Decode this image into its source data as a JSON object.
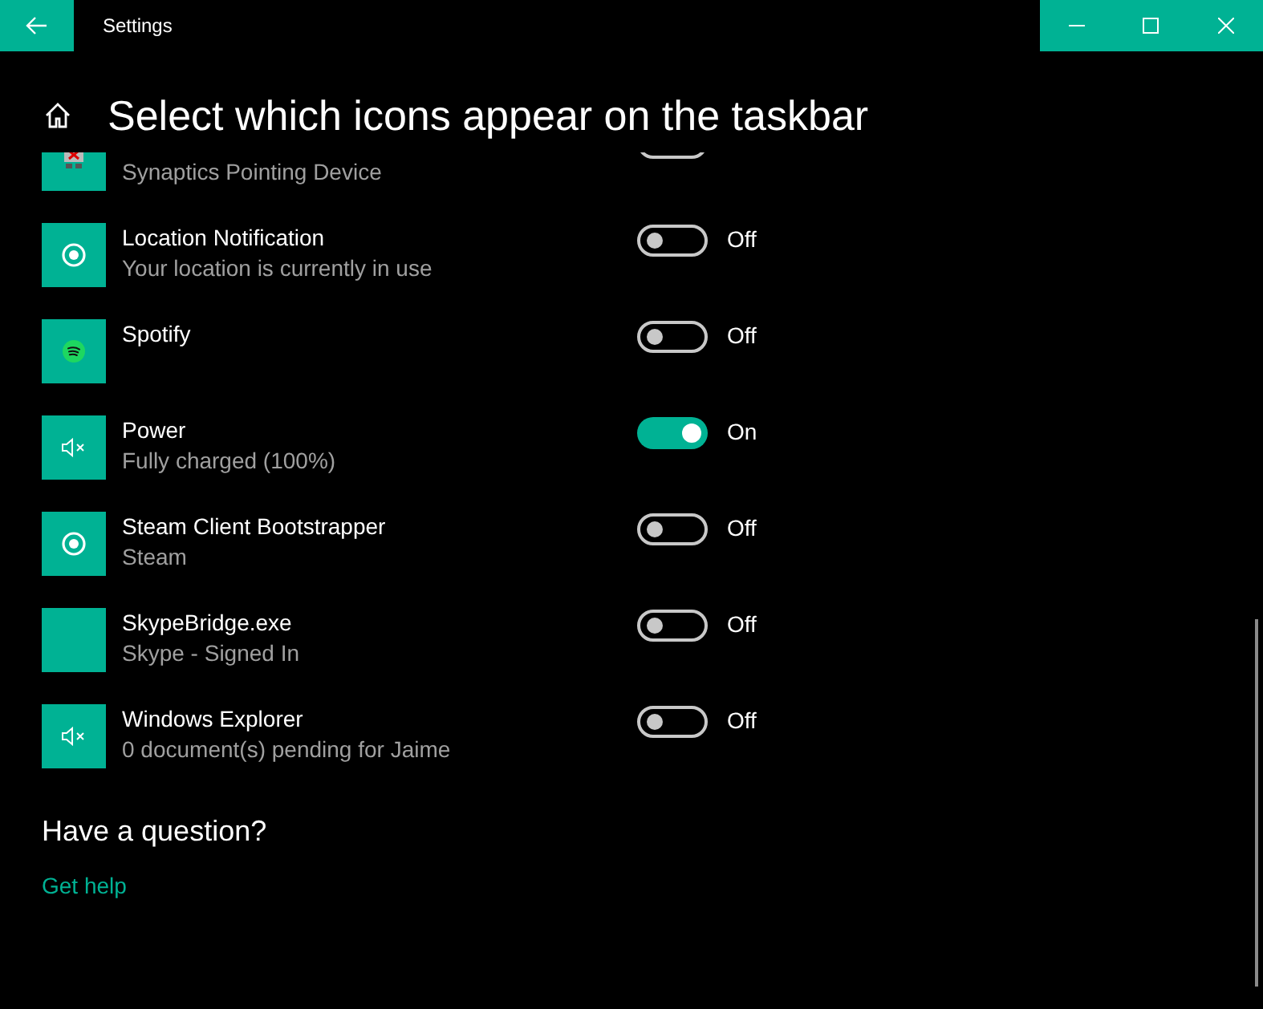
{
  "window": {
    "title": "Settings"
  },
  "page_title": "Select which icons appear on the taskbar",
  "items": [
    {
      "kind": "device",
      "subtitle": "Synaptics Pointing Device",
      "on": false
    },
    {
      "kind": "location",
      "title": "Location Notification",
      "subtitle": "Your location is currently in use",
      "on": false,
      "state_label": "Off"
    },
    {
      "kind": "spotify",
      "title": "Spotify",
      "on": false,
      "state_label": "Off"
    },
    {
      "kind": "mute",
      "title": "Power",
      "subtitle": "Fully charged (100%)",
      "on": true,
      "state_label": "On"
    },
    {
      "kind": "location",
      "title": "Steam Client Bootstrapper",
      "subtitle": "Steam",
      "on": false,
      "state_label": "Off"
    },
    {
      "kind": "blank",
      "title": "SkypeBridge.exe",
      "subtitle": "Skype - Signed In",
      "on": false,
      "state_label": "Off"
    },
    {
      "kind": "mute",
      "title": "Windows Explorer",
      "subtitle": "0 document(s) pending for Jaime",
      "on": false,
      "state_label": "Off"
    }
  ],
  "help": {
    "heading": "Have a question?",
    "link": "Get help"
  }
}
